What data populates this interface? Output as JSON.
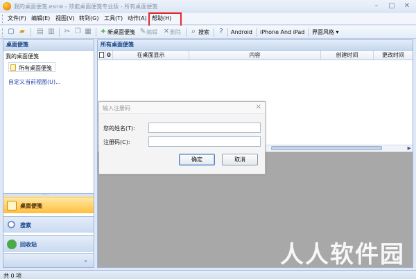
{
  "window": {
    "title": "我的桌面便笺.esnw - 效能桌面便笺专业版 - 所有桌面便笺",
    "minimize": "–",
    "maximize": "□",
    "close": "✕"
  },
  "menu": {
    "items": [
      "文件(F)",
      "编辑(E)",
      "视图(V)",
      "转到(G)",
      "工具(T)",
      "动作(A)",
      "帮助(H)"
    ],
    "highlighted": "帮助(H)"
  },
  "toolbar": {
    "new_note": "新桌面便笺",
    "edit": "编辑",
    "delete": "删除",
    "search": "搜索",
    "android": "Android",
    "iphone_ipad": "iPhone And iPad",
    "skin": "界面风格 ▾"
  },
  "sidebar": {
    "header": "桌面便笺",
    "tree_root": "我的桌面便笺",
    "tree_selected": "所有桌面便笺",
    "custom_view": "自定义当前视图(U)...",
    "splitter_dots": "·····",
    "nav": [
      {
        "label": "桌面便笺"
      },
      {
        "label": "搜索"
      },
      {
        "label": "回收站"
      }
    ],
    "footer_chevron": "⌄"
  },
  "main": {
    "header": "所有桌面便笺",
    "columns": [
      "在桌面显示",
      "内容",
      "创建时间",
      "更改时间"
    ],
    "attach_col": "0"
  },
  "dialog": {
    "title": "输入注册码",
    "close": "×",
    "name_label": "您的姓名(T):",
    "code_label": "注册码(C):",
    "name_value": "",
    "code_value": "",
    "ok": "确定",
    "cancel": "取消"
  },
  "status": {
    "text": "共 0 项"
  },
  "watermark": "人人软件园",
  "colors": {
    "highlight_box": "#e8262c",
    "accent": "#15428b",
    "active_nav": "#ffbe3d"
  }
}
